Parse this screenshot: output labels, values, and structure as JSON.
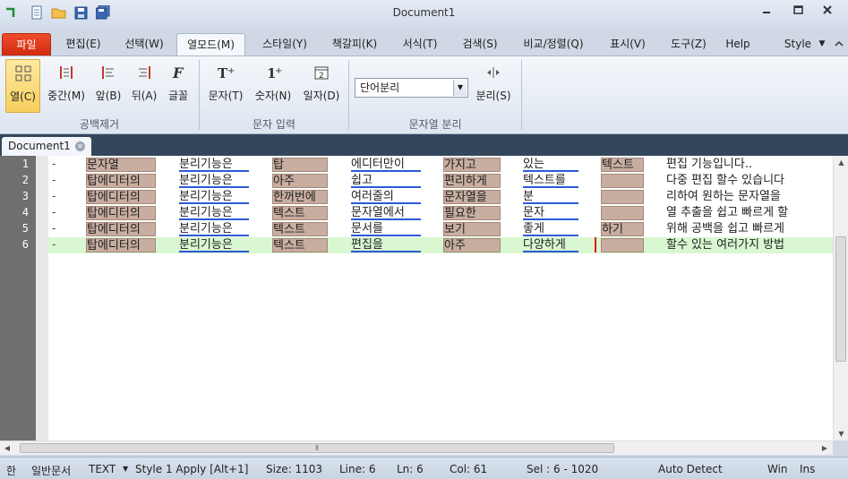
{
  "window": {
    "title": "Document1"
  },
  "menu_tabs": [
    {
      "label": "파일"
    },
    {
      "label": "편집(E)"
    },
    {
      "label": "선택(W)"
    },
    {
      "label": "열모드(M)"
    },
    {
      "label": "스타일(Y)"
    },
    {
      "label": "책갈피(K)"
    },
    {
      "label": "서식(T)"
    },
    {
      "label": "검색(S)"
    },
    {
      "label": "비교/정렬(Q)"
    },
    {
      "label": "표시(V)"
    },
    {
      "label": "도구(Z)"
    },
    {
      "label": "Help"
    },
    {
      "label": "Style"
    }
  ],
  "ribbon": {
    "group1": {
      "label": "공백제거",
      "buttons": [
        {
          "label": "열(C)",
          "icon": "grid-icon"
        },
        {
          "label": "중간(M)",
          "icon": "align-middle-icon"
        },
        {
          "label": "앞(B)",
          "icon": "align-left-icon"
        },
        {
          "label": "뒤(A)",
          "icon": "align-right-icon"
        },
        {
          "label": "글꼴",
          "icon": "font-icon"
        }
      ]
    },
    "group2": {
      "label": "문자 입력",
      "buttons": [
        {
          "label": "문자(T)",
          "icon": "text-plus-icon"
        },
        {
          "label": "숫자(N)",
          "icon": "number-plus-icon"
        },
        {
          "label": "일자(D)",
          "icon": "calendar-icon"
        }
      ]
    },
    "group3": {
      "label": "문자열 분리",
      "combo_value": "단어분리",
      "split_label": "분리(S)"
    }
  },
  "doc_tab": {
    "label": "Document1"
  },
  "editor": {
    "line_numbers": [
      "1",
      "2",
      "3",
      "4",
      "5",
      "6"
    ],
    "rows": [
      {
        "c": [
          "문자열",
          "분리기능은",
          "탑",
          "에디터만이",
          "가지고",
          "있는",
          "텍스트"
        ],
        "rest": "편집 기능입니다.."
      },
      {
        "c": [
          "탑에디터의",
          "분리기능은",
          "아주",
          "쉽고",
          "편리하게",
          "텍스트를",
          ""
        ],
        "rest": "다중 편집 할수 있습니다"
      },
      {
        "c": [
          "탑에디터의",
          "분리기능은",
          "한꺼번에",
          "여러줄의",
          "문자열을",
          "분",
          ""
        ],
        "rest": "리하여 원하는 문자열을"
      },
      {
        "c": [
          "탑에디터의",
          "분리기능은",
          "텍스트",
          "문자열에서",
          "필요한",
          "문자",
          ""
        ],
        "rest": "열 추출을 쉽고 빠르게 할"
      },
      {
        "c": [
          "탑에디터의",
          "분리기능은",
          "텍스트",
          "문서를",
          "보기",
          "좋게",
          "하기"
        ],
        "rest": "위해 공백을 쉽고 빠르게"
      },
      {
        "c": [
          "탑에디터의",
          "분리기능은",
          "텍스트",
          "편집을",
          "아주",
          "다양하게",
          ""
        ],
        "rest": "할수 있는 여러가지 방법"
      }
    ]
  },
  "status": {
    "ime": "한",
    "doc_type": "일반문서",
    "mode": "TEXT",
    "style": "Style 1 Apply [Alt+1]",
    "size": "Size: 1103",
    "line": "Line: 6",
    "ln": "Ln: 6",
    "col": "Col: 61",
    "sel": "Sel : 6 - 1020",
    "encoding": "Auto Detect",
    "eol": "Win",
    "ins": "Ins"
  }
}
